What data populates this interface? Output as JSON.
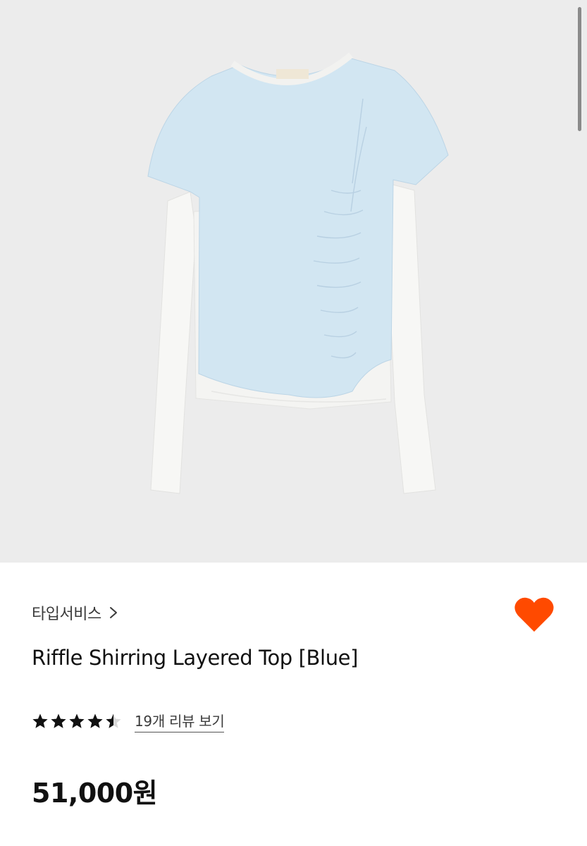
{
  "product": {
    "image_alt": "Riffle Shirring Layered Top [Blue]",
    "brand": "타입서비스",
    "brand_chevron_icon": "chevron-right-icon",
    "wishlist_icon": "heart-icon",
    "wishlist_active": true,
    "title": "Riffle Shirring Layered Top [Blue]",
    "rating": 4.5,
    "rating_max": 5,
    "review_link": "19개 리뷰 보기",
    "price": "51,000원"
  },
  "colors": {
    "heart": "#ff4a00",
    "hero_background": "#ececec",
    "shirt_blue": "#d2e6f2",
    "sleeve_white": "#f7f7f5"
  }
}
